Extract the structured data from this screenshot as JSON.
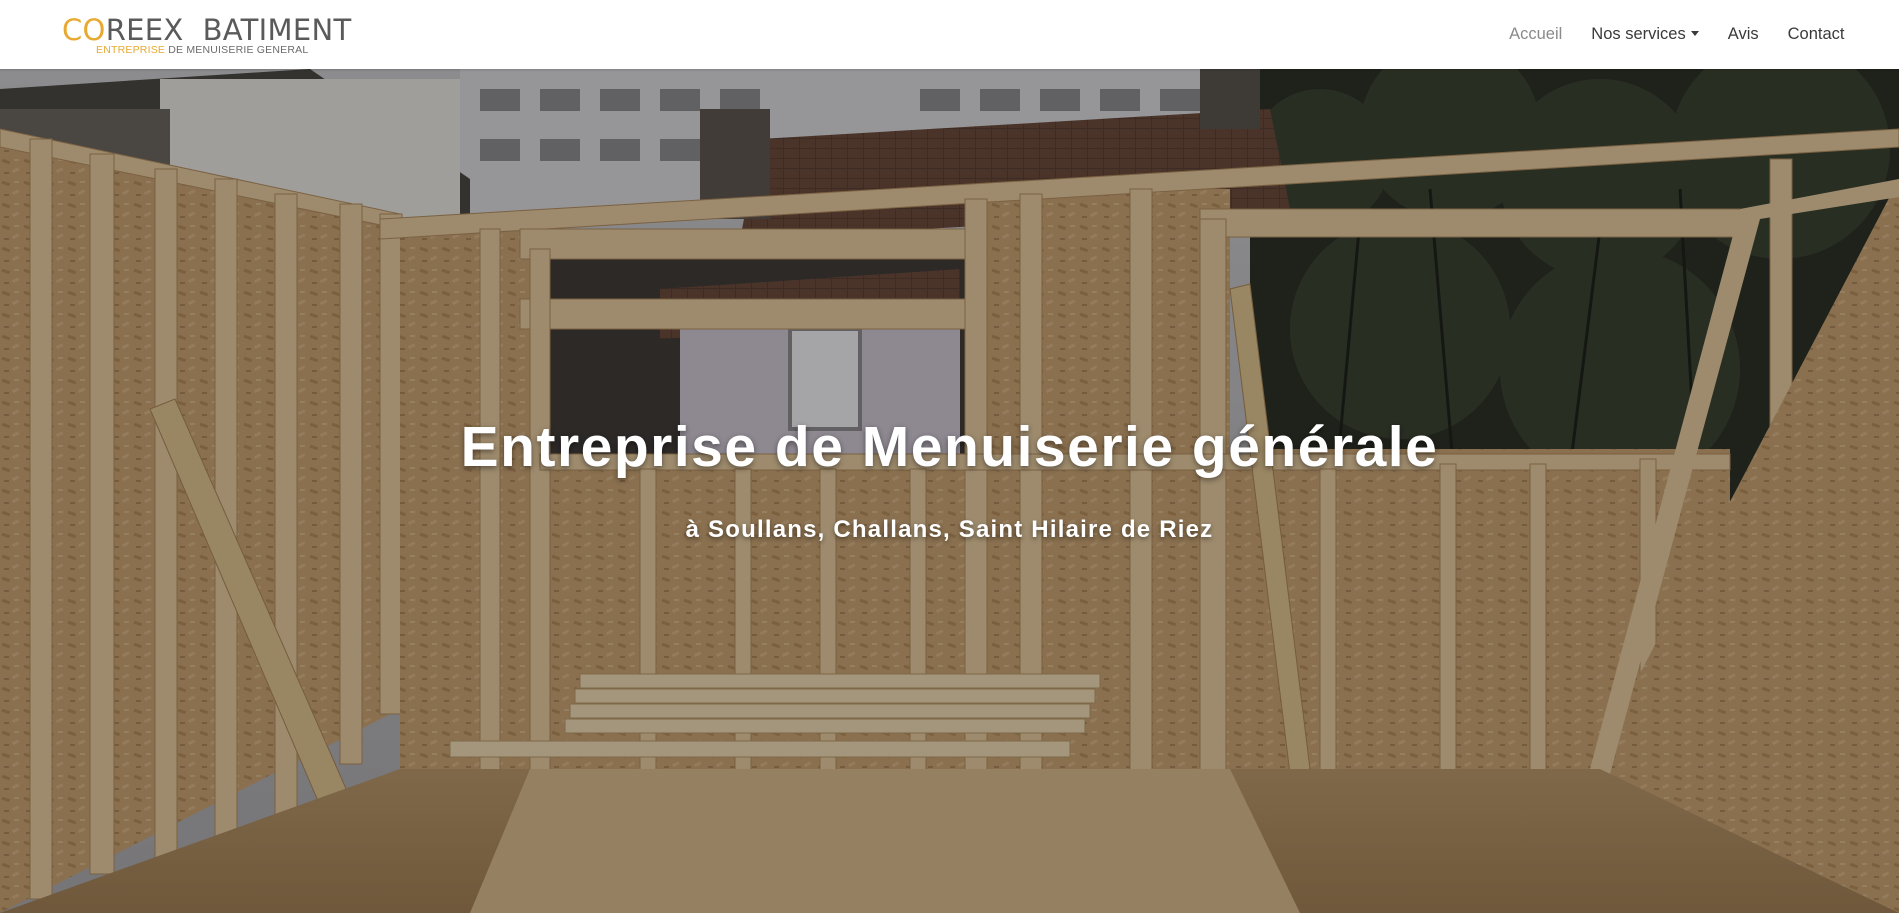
{
  "header": {
    "brand": {
      "logo_accent": "CO",
      "logo_rest": "REEX  BATIMENT",
      "tagline_accent": "ENTREPRISE",
      "tagline_rest": " DE MENUISERIE GENERAL"
    },
    "nav": {
      "items": [
        {
          "label": "Accueil",
          "active": true
        },
        {
          "label": "Nos services",
          "dropdown": true
        },
        {
          "label": "Avis"
        },
        {
          "label": "Contact"
        }
      ]
    }
  },
  "hero": {
    "title": "Entreprise de Menuiserie générale",
    "subtitle": "à Soullans, Challans, Saint Hilaire de Riez"
  },
  "colors": {
    "accent": "#e8a931",
    "nav_text": "#3a3a3a",
    "nav_active": "#8a8a8a",
    "hero_text": "#ffffff"
  }
}
